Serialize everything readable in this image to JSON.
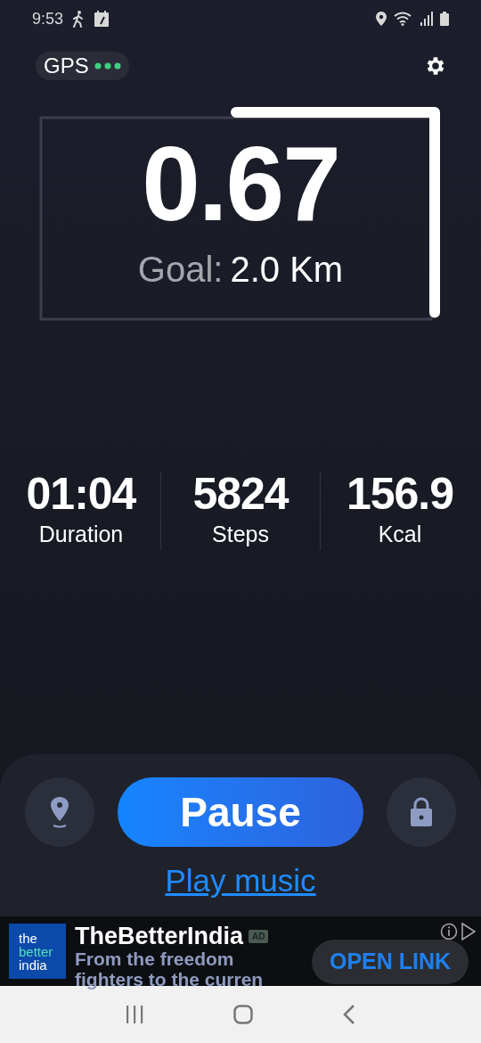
{
  "status_bar": {
    "time": "9:53"
  },
  "gps": {
    "label": "GPS"
  },
  "progress": {
    "value": "0.67",
    "goal_label": "Goal:",
    "goal_value": "2.0 Km"
  },
  "stats": [
    {
      "value": "01:04",
      "label": "Duration"
    },
    {
      "value": "5824",
      "label": "Steps"
    },
    {
      "value": "156.9",
      "label": "Kcal"
    }
  ],
  "controls": {
    "primary_button": "Pause",
    "music_link": "Play music"
  },
  "ad": {
    "logo_lines": [
      "the",
      "better",
      "india"
    ],
    "title": "TheBetterIndia",
    "badge": "AD",
    "description": [
      "From the freedom",
      "fighters to the curren"
    ],
    "button": "OPEN LINK"
  }
}
